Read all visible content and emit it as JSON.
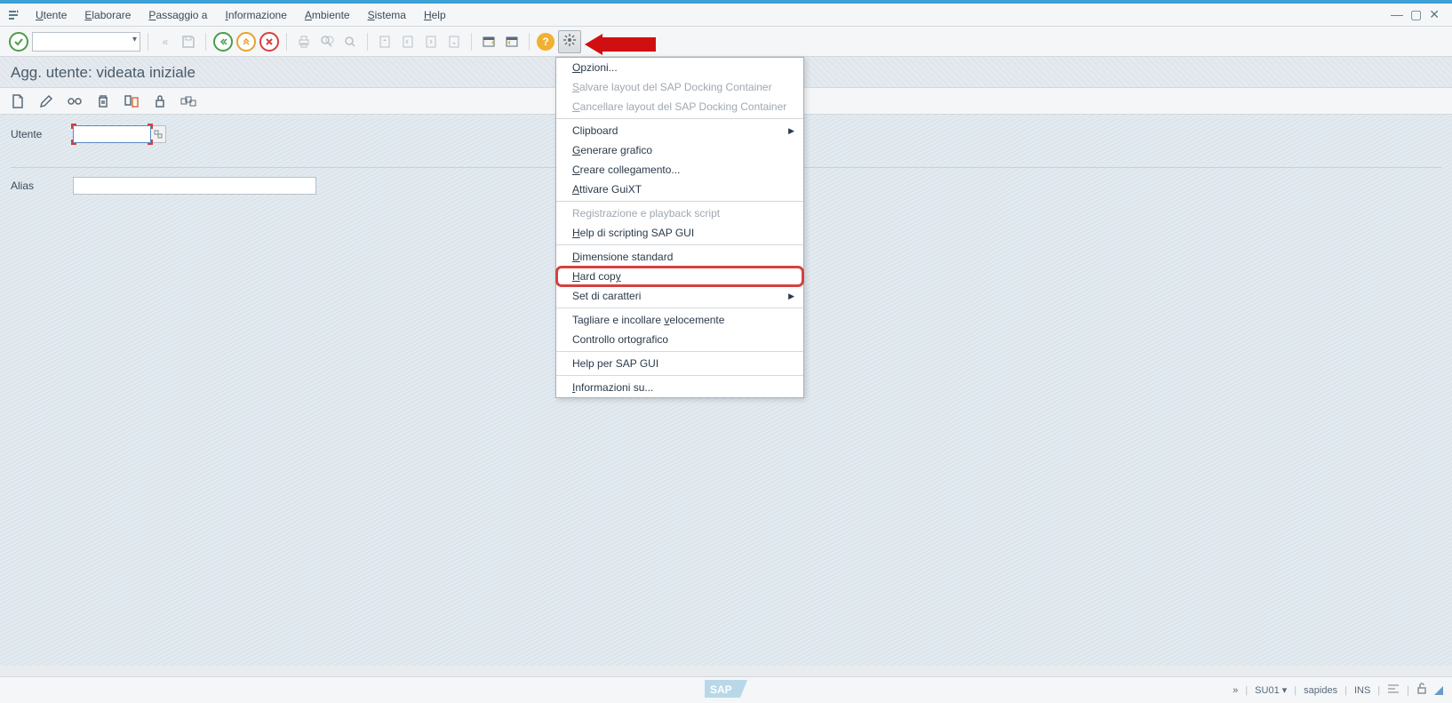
{
  "menubar": {
    "items": [
      "Utente",
      "Elaborare",
      "Passaggio a",
      "Informazione",
      "Ambiente",
      "Sistema",
      "Help"
    ],
    "underlines": [
      "U",
      "E",
      "P",
      "I",
      "A",
      "S",
      "H"
    ]
  },
  "page": {
    "title": "Agg. utente: videata iniziale"
  },
  "form": {
    "utente_label": "Utente",
    "utente_value": "",
    "alias_label": "Alias",
    "alias_value": ""
  },
  "dropdown": {
    "opzioni": "Opzioni...",
    "salvare": "Salvare layout del SAP Docking Container",
    "cancellare": "Cancellare layout del SAP Docking Container",
    "clipboard": "Clipboard",
    "generare": "Generare grafico",
    "creare": "Creare collegamento...",
    "attivare": "Attivare GuiXT",
    "registrazione": "Registrazione e playback script",
    "help_scripting": "Help di scripting SAP GUI",
    "dimensione": "Dimensione standard",
    "hardcopy": "Hard copy",
    "set_caratteri": "Set di caratteri",
    "tagliare": "Tagliare e incollare velocemente",
    "controllo": "Controllo ortografico",
    "help_gui": "Help per SAP GUI",
    "informazioni": "Informazioni su..."
  },
  "statusbar": {
    "chevron": "»",
    "tcode": "SU01",
    "tcode_caret": "▾",
    "system": "sapides",
    "mode": "INS"
  }
}
